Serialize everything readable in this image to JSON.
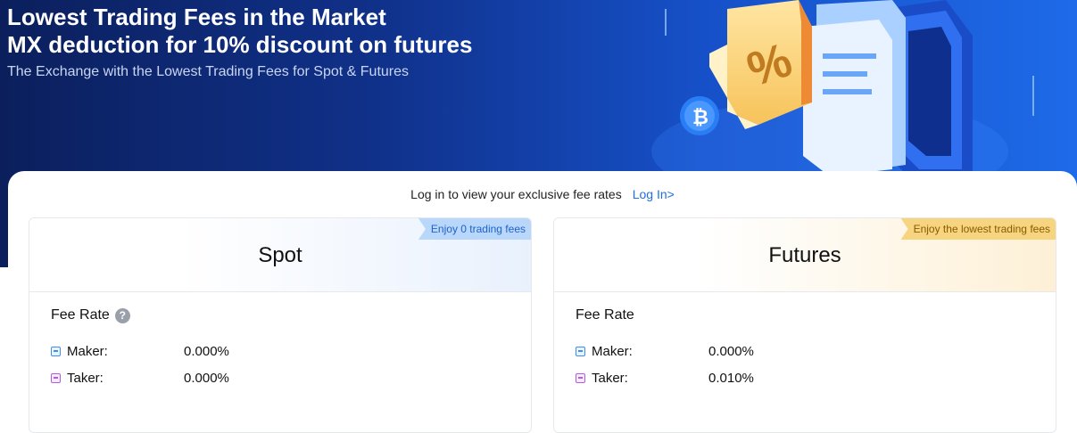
{
  "hero": {
    "title_line1": "Lowest Trading Fees in the Market",
    "title_line2": "MX deduction for 10% discount on futures",
    "subtitle": "The Exchange with the Lowest Trading Fees for Spot & Futures",
    "illustration_icons": [
      "percent-tag-icon",
      "bitcoin-coin-icon"
    ]
  },
  "login": {
    "prompt": "Log in to view your exclusive fee rates",
    "link": "Log In>"
  },
  "cards": {
    "spot": {
      "title": "Spot",
      "ribbon": "Enjoy 0 trading fees",
      "fee_title": "Fee Rate",
      "help_icon_text": "?",
      "maker_label": "Maker:",
      "maker_value": "0.000%",
      "taker_label": "Taker:",
      "taker_value": "0.000%"
    },
    "futures": {
      "title": "Futures",
      "ribbon": "Enjoy the lowest trading fees",
      "fee_title": "Fee Rate",
      "maker_label": "Maker:",
      "maker_value": "0.000%",
      "taker_label": "Taker:",
      "taker_value": "0.010%"
    }
  },
  "colors": {
    "hero_dark": "#0b1f5c",
    "hero_light": "#1e6ae8",
    "link": "#1f6fe0",
    "spot_ribbon": "#b9d6fb",
    "futures_ribbon": "#f7d47f",
    "maker_icon": "#3d8ef0",
    "taker_icon": "#b45be0"
  }
}
